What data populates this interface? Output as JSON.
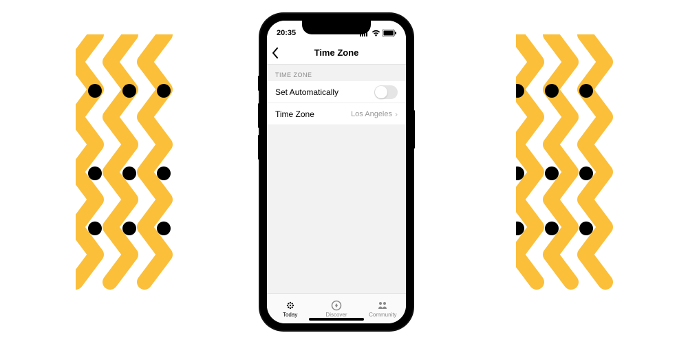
{
  "statusbar": {
    "time": "20:35"
  },
  "navbar": {
    "title": "Time Zone"
  },
  "section": {
    "header": "TIME ZONE",
    "rows": {
      "auto": {
        "label": "Set Automatically",
        "on": false
      },
      "zone": {
        "label": "Time Zone",
        "value": "Los Angeles"
      }
    }
  },
  "tabs": {
    "today": {
      "label": "Today"
    },
    "discover": {
      "label": "Discover"
    },
    "community": {
      "label": "Community"
    }
  },
  "decor": {
    "color": "#fbbf3a"
  }
}
